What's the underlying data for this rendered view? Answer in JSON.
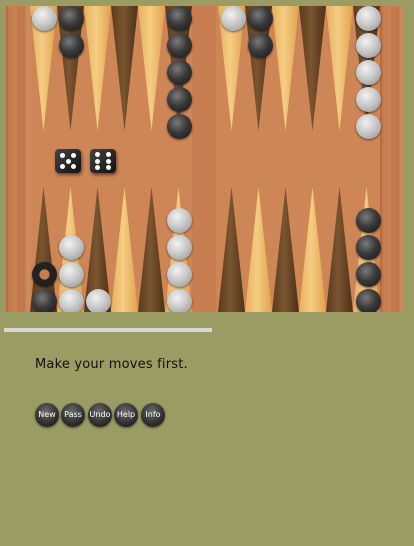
{
  "status_message": "Make your moves first.",
  "buttons": [
    {
      "label": "New"
    },
    {
      "label": "Pass"
    },
    {
      "label": "Undo"
    },
    {
      "label": "Help"
    },
    {
      "label": "Info"
    }
  ],
  "dice": [
    5,
    6
  ],
  "colors": {
    "page_background": "#9b9b64",
    "white_checker": "#c9c9c9",
    "black_checker": "#2a2a2a",
    "light_point": "#f0c070",
    "dark_point": "#6a4826"
  }
}
